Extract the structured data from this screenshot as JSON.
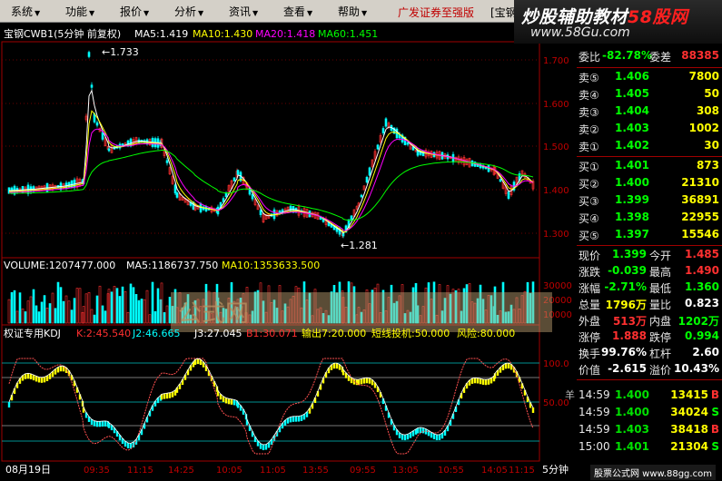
{
  "menu": {
    "items": [
      "系统",
      "功能",
      "报价",
      "分析",
      "资讯",
      "查看",
      "帮助"
    ],
    "broker": "广发证券至强版",
    "tab_partial": "[宝钢"
  },
  "logo": {
    "text_prefix": "炒股辅助教材",
    "text_highlight": "58股网",
    "url": "www.58Gu.com"
  },
  "main_chart": {
    "title": "宝钢CWB1(5分钟 前复权)",
    "ma_labels": [
      {
        "label": "MA5:1.419",
        "color": "#ffffff"
      },
      {
        "label": "MA10:1.430",
        "color": "#ffff00"
      },
      {
        "label": "MA20:1.418",
        "color": "#ff00ff"
      },
      {
        "label": "MA60:1.451",
        "color": "#00ff00"
      }
    ],
    "y_ticks": [
      "1.700",
      "1.600",
      "1.500",
      "1.400",
      "1.300"
    ],
    "high_marker": "1.733",
    "low_marker": "1.281"
  },
  "volume_chart": {
    "title": "VOLUME:1207477.000",
    "ma5": "MA5:1186737.750",
    "ma10": "MA10:1353633.500",
    "y_ticks": [
      "30000",
      "20000",
      "10000"
    ],
    "watermark": "公式网"
  },
  "kdj_chart": {
    "title": "权证专用KDJ",
    "k": "K:2:45.540",
    "j2": "J2:46.665",
    "j3": "J3:27.045",
    "b1": "B1:30.071",
    "out": "输出7:20.000",
    "short": "短线投机:50.000",
    "risk": "风险:80.000",
    "y_ticks": [
      "100.0",
      "50.00"
    ]
  },
  "x_axis": {
    "date": "08月19日",
    "times": [
      "09:35",
      "11:15",
      "14:25",
      "10:05",
      "11:05",
      "13:55",
      "09:55",
      "13:05",
      "10:55",
      "14:05",
      "11:15",
      "13:25"
    ],
    "period": "5分钟",
    "tab_label": "羊"
  },
  "quote": {
    "ratio_label": "委比",
    "ratio_value": "-82.78%",
    "diff_label": "委差",
    "diff_value": "88385",
    "asks": [
      {
        "label": "卖⑤",
        "price": "1.406",
        "vol": "7800"
      },
      {
        "label": "卖④",
        "price": "1.405",
        "vol": "50"
      },
      {
        "label": "卖③",
        "price": "1.404",
        "vol": "308"
      },
      {
        "label": "卖②",
        "price": "1.403",
        "vol": "1002"
      },
      {
        "label": "卖①",
        "price": "1.402",
        "vol": "30"
      }
    ],
    "bids": [
      {
        "label": "买①",
        "price": "1.401",
        "vol": "873"
      },
      {
        "label": "买②",
        "price": "1.400",
        "vol": "21310"
      },
      {
        "label": "买③",
        "price": "1.399",
        "vol": "36891"
      },
      {
        "label": "买④",
        "price": "1.398",
        "vol": "22955"
      },
      {
        "label": "买⑤",
        "price": "1.397",
        "vol": "15546"
      }
    ],
    "stats": [
      {
        "l1": "现价",
        "v1": "1.399",
        "c1": "#00ff00",
        "l2": "今开",
        "v2": "1.485",
        "c2": "#ff3030"
      },
      {
        "l1": "涨跌",
        "v1": "-0.039",
        "c1": "#00ff00",
        "l2": "最高",
        "v2": "1.490",
        "c2": "#ff3030"
      },
      {
        "l1": "涨幅",
        "v1": "-2.71%",
        "c1": "#00ff00",
        "l2": "最低",
        "v2": "1.360",
        "c2": "#00ff00"
      },
      {
        "l1": "总量",
        "v1": "1796万",
        "c1": "#ffff00",
        "l2": "量比",
        "v2": "0.823",
        "c2": "#ffffff"
      },
      {
        "l1": "外盘",
        "v1": "513万",
        "c1": "#ff3030",
        "l2": "内盘",
        "v2": "1202万",
        "c2": "#00ff00"
      },
      {
        "l1": "涨停",
        "v1": "1.888",
        "c1": "#ff3030",
        "l2": "跌停",
        "v2": "0.994",
        "c2": "#00ff00"
      },
      {
        "l1": "换手",
        "v1": "99.76%",
        "c1": "#ffffff",
        "l2": "杠杆",
        "v2": "2.60",
        "c2": "#ffffff"
      },
      {
        "l1": "价值",
        "v1": "-2.615",
        "c1": "#ffffff",
        "l2": "溢价",
        "v2": "10.43%",
        "c2": "#ffffff"
      }
    ],
    "ticks": [
      {
        "time": "14:59",
        "price": "1.400",
        "vol": "13415",
        "dir": "B",
        "color": "#ff3030"
      },
      {
        "time": "14:59",
        "price": "1.400",
        "vol": "34024",
        "dir": "S",
        "color": "#00ff00"
      },
      {
        "time": "14:59",
        "price": "1.403",
        "vol": "38418",
        "dir": "B",
        "color": "#ff3030"
      },
      {
        "time": "15:00",
        "price": "1.401",
        "vol": "21304",
        "dir": "S",
        "color": "#00ff00"
      }
    ]
  },
  "credit": "股票公式网 www.88gg.com"
}
